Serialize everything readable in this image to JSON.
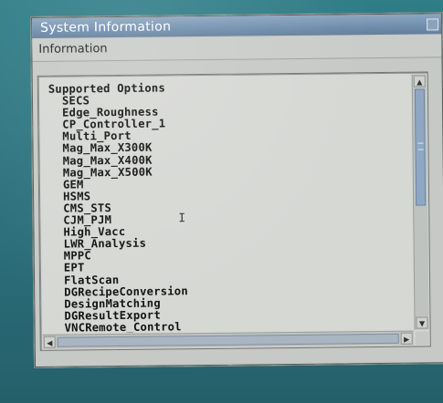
{
  "window": {
    "title": "System Information"
  },
  "menubar": {
    "items": [
      "Information"
    ]
  },
  "panel": {
    "heading": "Supported Options",
    "options": [
      "SECS",
      "Edge_Roughness",
      "CP_Controller_1",
      "Multi_Port",
      "Mag_Max_X300K",
      "Mag_Max_X400K",
      "Mag_Max_X500K",
      "GEM",
      "HSMS",
      "CMS_STS",
      "CJM_PJM",
      "High_Vacc",
      "LWR_Analysis",
      "MPPC",
      "EPT",
      "FlatScan",
      "DGRecipeConversion",
      "DesignMatching",
      "DGResultExport",
      "VNCRemote_Control"
    ]
  },
  "scrollbars": {
    "vertical_position": 0.0,
    "horizontal_position": 0.0
  },
  "icons": {
    "up_arrow": "arrow-up-icon",
    "down_arrow": "arrow-down-icon",
    "left_arrow": "arrow-left-icon",
    "right_arrow": "arrow-right-icon",
    "text_cursor": "text-cursor-icon"
  },
  "colors": {
    "titlebar": "#6f8ead",
    "desktop": "#2b6f7b",
    "scroll_thumb": "#8fa7c3"
  }
}
